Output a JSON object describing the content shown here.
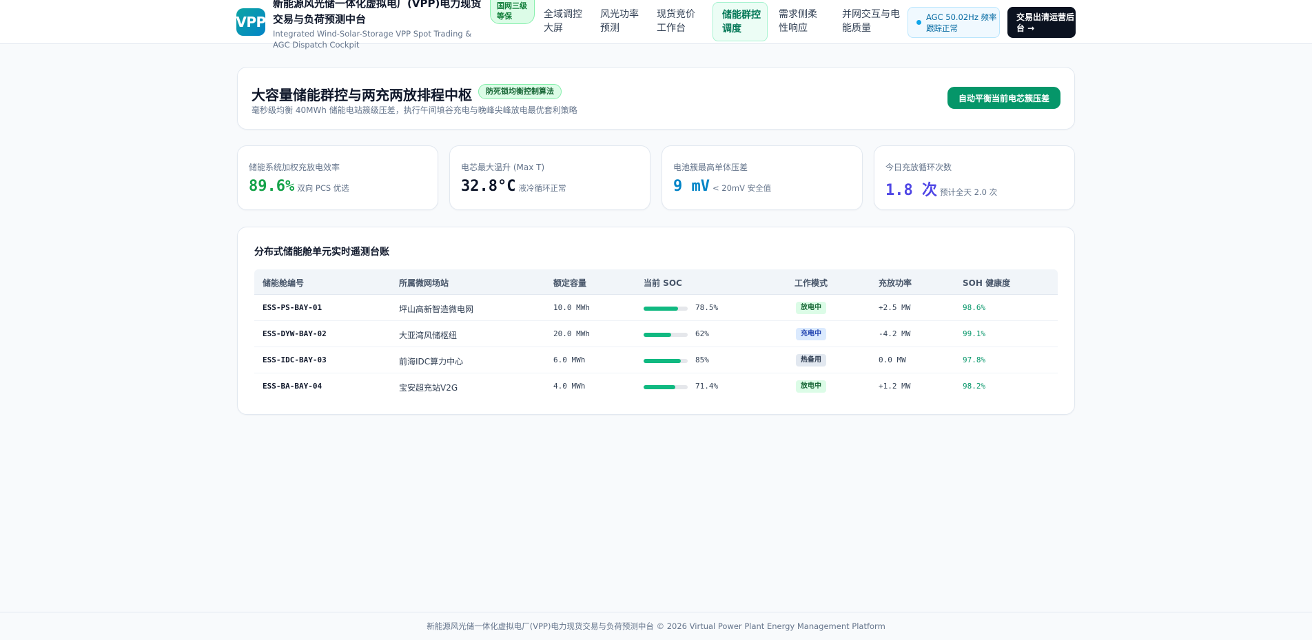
{
  "header": {
    "logo_text": "VPP",
    "brand_title": "新能源风光储一体化虚拟电厂(VPP)电力现货交易与负荷预测中台",
    "brand_subtitle": "Integrated Wind-Solar-Storage VPP Spot Trading & AGC Dispatch Cockpit",
    "cert_badge": "国网三级等保",
    "nav": [
      {
        "label": "全域调控大屏"
      },
      {
        "label": "风光功率预测"
      },
      {
        "label": "现货竞价工作台"
      },
      {
        "label": "储能群控调度"
      },
      {
        "label": "需求侧柔性响应"
      },
      {
        "label": "并网交互与电能质量"
      }
    ],
    "agc_status": "AGC 50.02Hz 频率跟踪正常",
    "admin_button": "交易出清运营后台 →"
  },
  "hero": {
    "title": "大容量储能群控与两充两放排程中枢",
    "badge": "防死锁均衡控制算法",
    "subtitle": "毫秒级均衡 40MWh 储能电站簇级压差，执行午间填谷充电与晚峰尖峰放电最优套利策略",
    "action_button": "自动平衡当前电芯簇压差"
  },
  "kpis": [
    {
      "label": "储能系统加权充放电效率",
      "value": "89.6%",
      "note": "双向 PCS 优选",
      "color": "#16a34a"
    },
    {
      "label": "电芯最大温升 (Max T)",
      "value": "32.8°C",
      "note": "液冷循环正常",
      "color": "#0f172a"
    },
    {
      "label": "电池簇最高单体压差",
      "value": "9 mV",
      "note": "< 20mV 安全值",
      "color": "#0284c7"
    },
    {
      "label": "今日充放循环次数",
      "value": "1.8 次",
      "note": "预计全天 2.0 次",
      "color": "#4f46e5"
    }
  ],
  "table": {
    "title": "分布式储能舱单元实时遥测台账",
    "columns": [
      "储能舱编号",
      "所属微网场站",
      "额定容量",
      "当前 SOC",
      "工作模式",
      "充放功率",
      "SOH 健康度"
    ],
    "rows": [
      {
        "id": "ESS-PS-BAY-01",
        "station": "坪山高新智造微电网",
        "capacity": "10.0 MWh",
        "soc": "78.5%",
        "soc_value": 78.5,
        "mode": "放电中",
        "mode_style": "green",
        "power": "+2.5 MW",
        "soh": "98.6%"
      },
      {
        "id": "ESS-DYW-BAY-02",
        "station": "大亚湾风储枢纽",
        "capacity": "20.0 MWh",
        "soc": "62%",
        "soc_value": 62,
        "mode": "充电中",
        "mode_style": "blue",
        "power": "-4.2 MW",
        "soh": "99.1%"
      },
      {
        "id": "ESS-IDC-BAY-03",
        "station": "前海IDC算力中心",
        "capacity": "6.0 MWh",
        "soc": "85%",
        "soc_value": 85,
        "mode": "热备用",
        "mode_style": "gray",
        "power": "0.0 MW",
        "soh": "97.8%"
      },
      {
        "id": "ESS-BA-BAY-04",
        "station": "宝安超充站V2G",
        "capacity": "4.0 MWh",
        "soc": "71.4%",
        "soc_value": 71.4,
        "mode": "放电中",
        "mode_style": "green",
        "power": "+1.2 MW",
        "soh": "98.2%"
      }
    ]
  },
  "footer": {
    "text": "新能源风光储一体化虚拟电厂(VPP)电力现货交易与负荷预测中台 © 2026 Virtual Power Plant Energy Management Platform"
  }
}
